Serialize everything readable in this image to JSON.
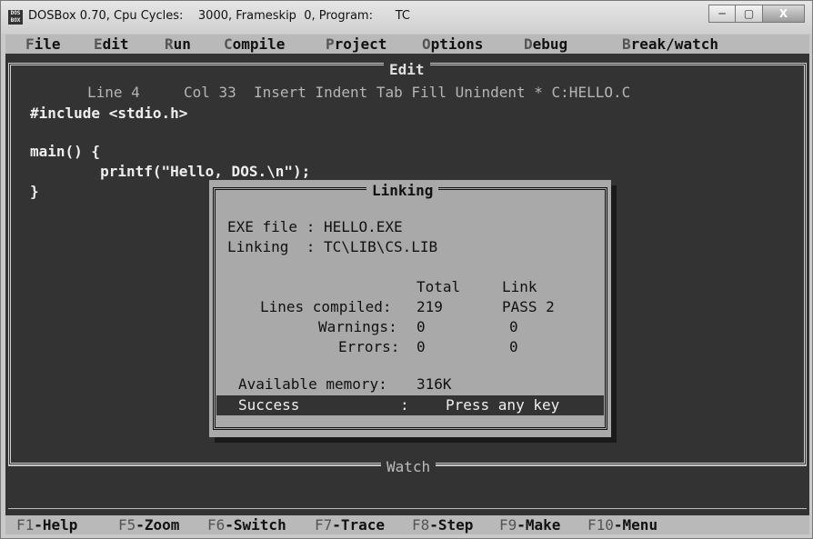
{
  "window": {
    "title": "DOSBox 0.70, Cpu Cycles:    3000, Frameskip  0, Program:      TC",
    "icon_label": "DOS BOX",
    "buttons": {
      "minimize": "─",
      "maximize": "▢",
      "close": "X"
    }
  },
  "menubar": [
    {
      "hot": "F",
      "rest": "ile"
    },
    {
      "hot": "E",
      "rest": "dit"
    },
    {
      "hot": "R",
      "rest": "un"
    },
    {
      "hot": "C",
      "rest": "ompile"
    },
    {
      "hot": "P",
      "rest": "roject"
    },
    {
      "hot": "O",
      "rest": "ptions"
    },
    {
      "hot": "D",
      "rest": "ebug"
    },
    {
      "hot": "B",
      "rest": "reak/watch"
    }
  ],
  "editor": {
    "title": "Edit",
    "status": "Line 4     Col 33  Insert Indent Tab Fill Unindent * C:HELLO.C",
    "code": [
      "#include <stdio.h>",
      "",
      "main() {",
      "        printf(\"Hello, DOS.\\n\");",
      "}"
    ]
  },
  "dialog": {
    "title": "Linking",
    "exe_file": "EXE file : HELLO.EXE",
    "linking": "Linking  : TC\\LIB\\CS.LIB",
    "header_total": "Total",
    "header_link": "Link",
    "rows": [
      {
        "label": "Lines compiled:",
        "total": "219",
        "link": "PASS 2"
      },
      {
        "label": "Warnings:",
        "total": "0",
        "link": "0"
      },
      {
        "label": "Errors:",
        "total": "0",
        "link": "0"
      }
    ],
    "memory_label": "Available memory:",
    "memory_value": "316K",
    "success": "Success",
    "colon": ":",
    "press": "Press any key"
  },
  "watch": {
    "title": "Watch"
  },
  "funcbar": [
    {
      "key": "F1",
      "label": "-Help"
    },
    {
      "key": "F5",
      "label": "-Zoom"
    },
    {
      "key": "F6",
      "label": "-Switch"
    },
    {
      "key": "F7",
      "label": "-Trace"
    },
    {
      "key": "F8",
      "label": "-Step"
    },
    {
      "key": "F9",
      "label": "-Make"
    },
    {
      "key": "F10",
      "label": "-Menu"
    }
  ]
}
